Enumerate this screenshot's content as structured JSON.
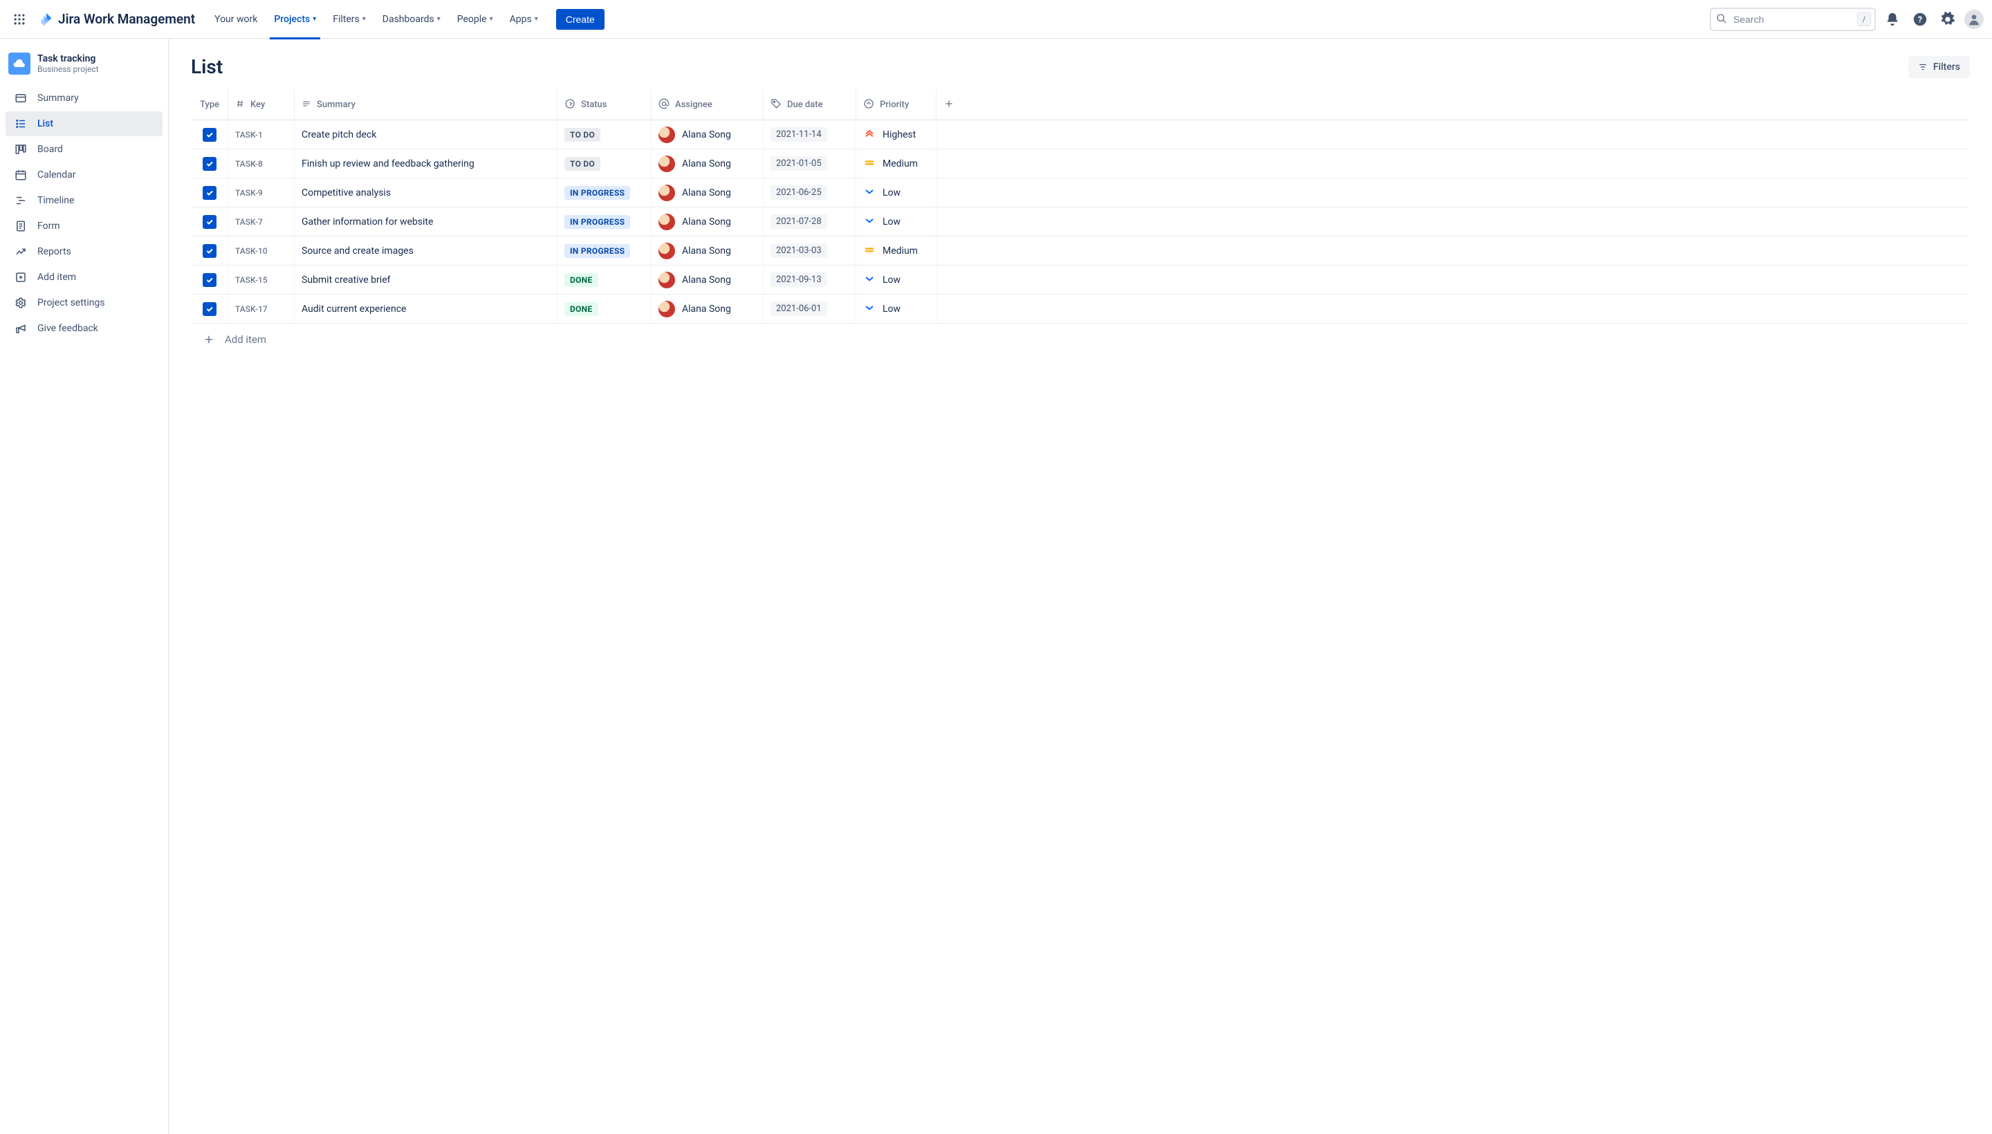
{
  "brand": "Jira Work Management",
  "nav": {
    "your_work": "Your work",
    "projects": "Projects",
    "filters": "Filters",
    "dashboards": "Dashboards",
    "people": "People",
    "apps": "Apps",
    "create": "Create"
  },
  "search": {
    "placeholder": "Search",
    "shortcut": "/"
  },
  "project": {
    "name": "Task tracking",
    "type": "Business project"
  },
  "sidebar": [
    {
      "id": "summary",
      "label": "Summary"
    },
    {
      "id": "list",
      "label": "List"
    },
    {
      "id": "board",
      "label": "Board"
    },
    {
      "id": "calendar",
      "label": "Calendar"
    },
    {
      "id": "timeline",
      "label": "Timeline"
    },
    {
      "id": "form",
      "label": "Form"
    },
    {
      "id": "reports",
      "label": "Reports"
    },
    {
      "id": "additem",
      "label": "Add item"
    },
    {
      "id": "settings",
      "label": "Project settings"
    },
    {
      "id": "feedback",
      "label": "Give feedback"
    }
  ],
  "page": {
    "title": "List",
    "filters_btn": "Filters",
    "add_row": "Add item"
  },
  "columns": {
    "type": "Type",
    "key": "Key",
    "summary": "Summary",
    "status": "Status",
    "assignee": "Assignee",
    "duedate": "Due date",
    "priority": "Priority"
  },
  "rows": [
    {
      "key": "TASK-1",
      "summary": "Create pitch deck",
      "status": "TO DO",
      "status_class": "todo",
      "assignee": "Alana Song",
      "due": "2021-11-14",
      "priority": "Highest",
      "prio_kind": "highest"
    },
    {
      "key": "TASK-8",
      "summary": "Finish up review and feedback gathering",
      "status": "TO DO",
      "status_class": "todo",
      "assignee": "Alana Song",
      "due": "2021-01-05",
      "priority": "Medium",
      "prio_kind": "medium"
    },
    {
      "key": "TASK-9",
      "summary": "Competitive analysis",
      "status": "IN PROGRESS",
      "status_class": "inprogress",
      "assignee": "Alana Song",
      "due": "2021-06-25",
      "priority": "Low",
      "prio_kind": "low"
    },
    {
      "key": "TASK-7",
      "summary": "Gather information for website",
      "status": "IN PROGRESS",
      "status_class": "inprogress",
      "assignee": "Alana Song",
      "due": "2021-07-28",
      "priority": "Low",
      "prio_kind": "low"
    },
    {
      "key": "TASK-10",
      "summary": "Source and create images",
      "status": "IN PROGRESS",
      "status_class": "inprogress",
      "assignee": "Alana Song",
      "due": "2021-03-03",
      "priority": "Medium",
      "prio_kind": "medium"
    },
    {
      "key": "TASK-15",
      "summary": "Submit creative brief",
      "status": "DONE",
      "status_class": "done",
      "assignee": "Alana Song",
      "due": "2021-09-13",
      "priority": "Low",
      "prio_kind": "low"
    },
    {
      "key": "TASK-17",
      "summary": "Audit current experience",
      "status": "DONE",
      "status_class": "done",
      "assignee": "Alana Song",
      "due": "2021-06-01",
      "priority": "Low",
      "prio_kind": "low"
    }
  ]
}
